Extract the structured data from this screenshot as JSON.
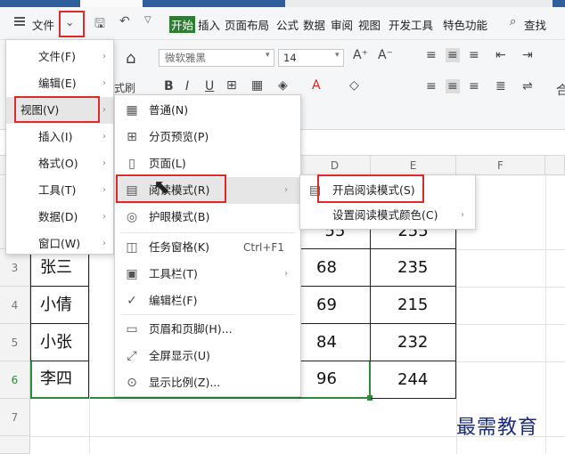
{
  "menubar": {
    "file": "文件",
    "start": "开始",
    "items": [
      "插入",
      "页面布局",
      "公式",
      "数据",
      "审阅",
      "视图",
      "开发工具",
      "特色功能"
    ],
    "search": "查找"
  },
  "ribbon": {
    "font_name": "微软雅黑",
    "font_size": "14",
    "format_painter_fragment": "式刷"
  },
  "columns": [
    "D",
    "E",
    "F"
  ],
  "rows": [
    {
      "num": "3",
      "name": "张三",
      "d": "68",
      "e": "235"
    },
    {
      "num": "4",
      "name": "小倩",
      "d": "69",
      "e": "215"
    },
    {
      "num": "5",
      "name": "小张",
      "d": "84",
      "e": "232"
    },
    {
      "num": "6",
      "name": "李四",
      "d": "96",
      "e": "244"
    },
    {
      "num": "7",
      "name": "",
      "d": "",
      "e": ""
    }
  ],
  "partial_row_values": {
    "d": "55",
    "e": "255"
  },
  "file_menu": [
    {
      "label": "文件(F)"
    },
    {
      "label": "编辑(E)"
    },
    {
      "label": "视图(V)"
    },
    {
      "label": "插入(I)"
    },
    {
      "label": "格式(O)"
    },
    {
      "label": "工具(T)"
    },
    {
      "label": "数据(D)"
    },
    {
      "label": "窗口(W)"
    }
  ],
  "view_menu": [
    {
      "label": "普通(N)",
      "icon": "grid-icon"
    },
    {
      "label": "分页预览(P)",
      "icon": "page-break-icon"
    },
    {
      "label": "页面(L)",
      "icon": "page-icon"
    },
    {
      "label": "阅读模式(R)",
      "icon": "reading-mode-icon"
    },
    {
      "label": "护眼模式(B)",
      "icon": "eye-icon"
    },
    {
      "label": "任务窗格(K)",
      "icon": "task-pane-icon",
      "shortcut": "Ctrl+F1"
    },
    {
      "label": "工具栏(T)",
      "icon": "toolbar-icon"
    },
    {
      "label": "编辑栏(F)",
      "icon": "check-icon"
    },
    {
      "label": "页眉和页脚(H)...",
      "icon": "header-footer-icon"
    },
    {
      "label": "全屏显示(U)",
      "icon": "fullscreen-icon"
    },
    {
      "label": "显示比例(Z)...",
      "icon": "zoom-icon"
    }
  ],
  "reading_submenu": [
    {
      "label": "开启阅读模式(S)"
    },
    {
      "label": "设置阅读模式颜色(C)"
    }
  ],
  "watermark": "最需教育"
}
